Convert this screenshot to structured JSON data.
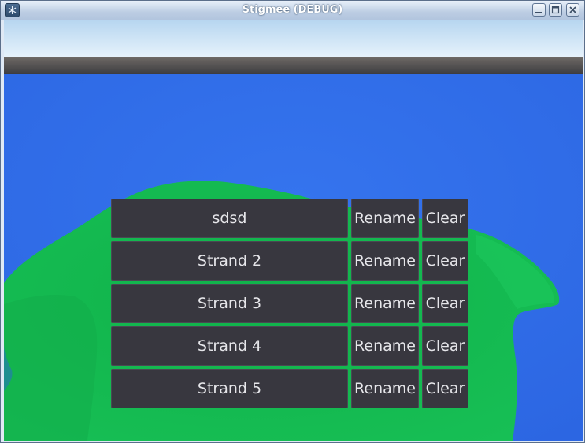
{
  "window": {
    "title": "Stigmee (DEBUG)",
    "app_icon": "stigmee-app-icon",
    "controls": [
      "minimize-icon",
      "maximize-icon",
      "close-icon"
    ]
  },
  "strands": [
    {
      "name": "sdsd",
      "rename_label": "Rename",
      "clear_label": "Clear"
    },
    {
      "name": "Strand 2",
      "rename_label": "Rename",
      "clear_label": "Clear"
    },
    {
      "name": "Strand 3",
      "rename_label": "Rename",
      "clear_label": "Clear"
    },
    {
      "name": "Strand 4",
      "rename_label": "Rename",
      "clear_label": "Clear"
    },
    {
      "name": "Strand 5",
      "rename_label": "Rename",
      "clear_label": "Clear"
    }
  ],
  "colors": {
    "sky": "#cfe6f7",
    "ground_edge": "#4a4849",
    "water": "#2f6ce8",
    "island": "#14b84f",
    "button_bg": "#38373f",
    "button_text": "#e6e6ea"
  }
}
